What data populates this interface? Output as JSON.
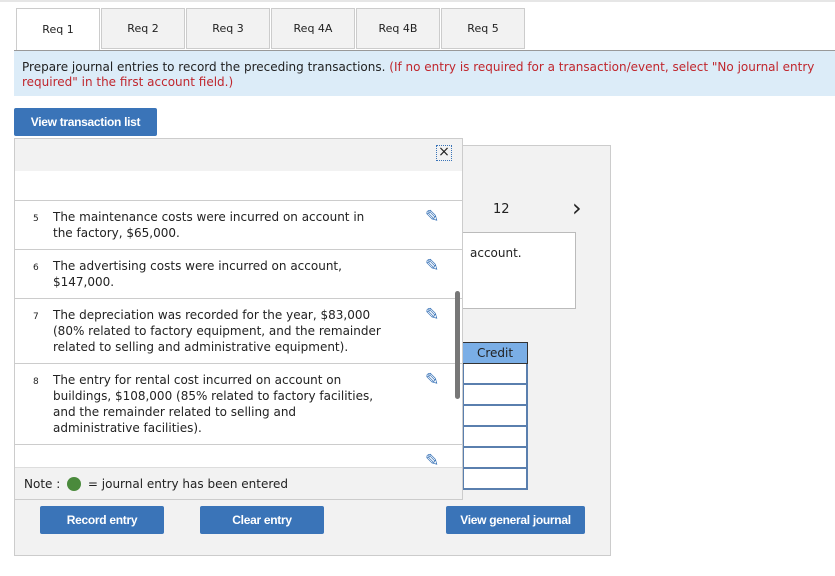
{
  "tabs": [
    "Req 1",
    "Req 2",
    "Req 3",
    "Req 4A",
    "Req 4B",
    "Req 5"
  ],
  "active_tab": "Req 1",
  "instructions": {
    "text": "Prepare journal entries to record the preceding transactions. ",
    "note": "(If no entry is required for a transaction/event, select \"No journal entry required\" in the first account field.)"
  },
  "view_transaction_list": "View transaction list",
  "popup": {
    "close": "×",
    "transactions": [
      {
        "num": "5",
        "text": "The maintenance costs were incurred on account in the factory, $65,000."
      },
      {
        "num": "6",
        "text": "The advertising costs were incurred on account, $147,000."
      },
      {
        "num": "7",
        "text": "The depreciation was recorded for the year, $83,000 (80% related to factory equipment, and the remainder related to selling and administrative equipment)."
      },
      {
        "num": "8",
        "text": "The entry for rental cost incurred on account on buildings, $108,000 (85% related to factory facilities, and the remainder related to selling and administrative facilities)."
      }
    ],
    "note_prefix": "Note : ",
    "note_suffix": "= journal entry has been entered"
  },
  "journal": {
    "page": "12",
    "next": "›",
    "desc": "account.",
    "credit_header": "Credit"
  },
  "buttons": {
    "record": "Record entry",
    "clear": "Clear entry",
    "view_gj": "View general journal"
  },
  "colors": {
    "accent": "#3a74b8",
    "entered": "#4a8a3c",
    "note_red": "#c0262d"
  }
}
